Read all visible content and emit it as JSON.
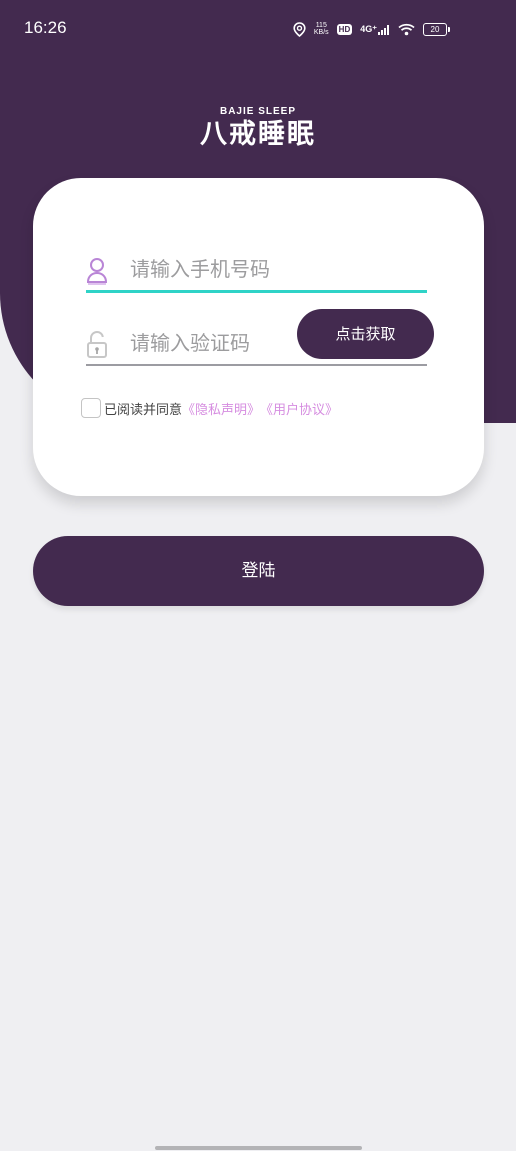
{
  "status_bar": {
    "time": "16:26",
    "speed_value": "115",
    "speed_unit": "KB/s",
    "hd": "HD",
    "network": "4G⁺",
    "battery": "20",
    "icons": [
      "location-icon",
      "hd-icon",
      "signal-icon",
      "wifi-icon",
      "battery-icon"
    ]
  },
  "logo": {
    "english": "BAJIE SLEEP",
    "chinese": "八戒睡眠"
  },
  "form": {
    "phone_placeholder": "请输入手机号码",
    "phone_value": "",
    "code_placeholder": "请输入验证码",
    "code_value": "",
    "get_code_label": "点击获取",
    "agree_prefix": "已阅读并同意",
    "privacy_link": "《隐私声明》",
    "terms_link": "《用户协议》",
    "agree_checked": false
  },
  "login": {
    "label": "登陆"
  },
  "colors": {
    "primary": "#432a4f",
    "accent_teal": "#2fd3c7",
    "link_pink": "#d68de0",
    "background": "#efeff2"
  }
}
